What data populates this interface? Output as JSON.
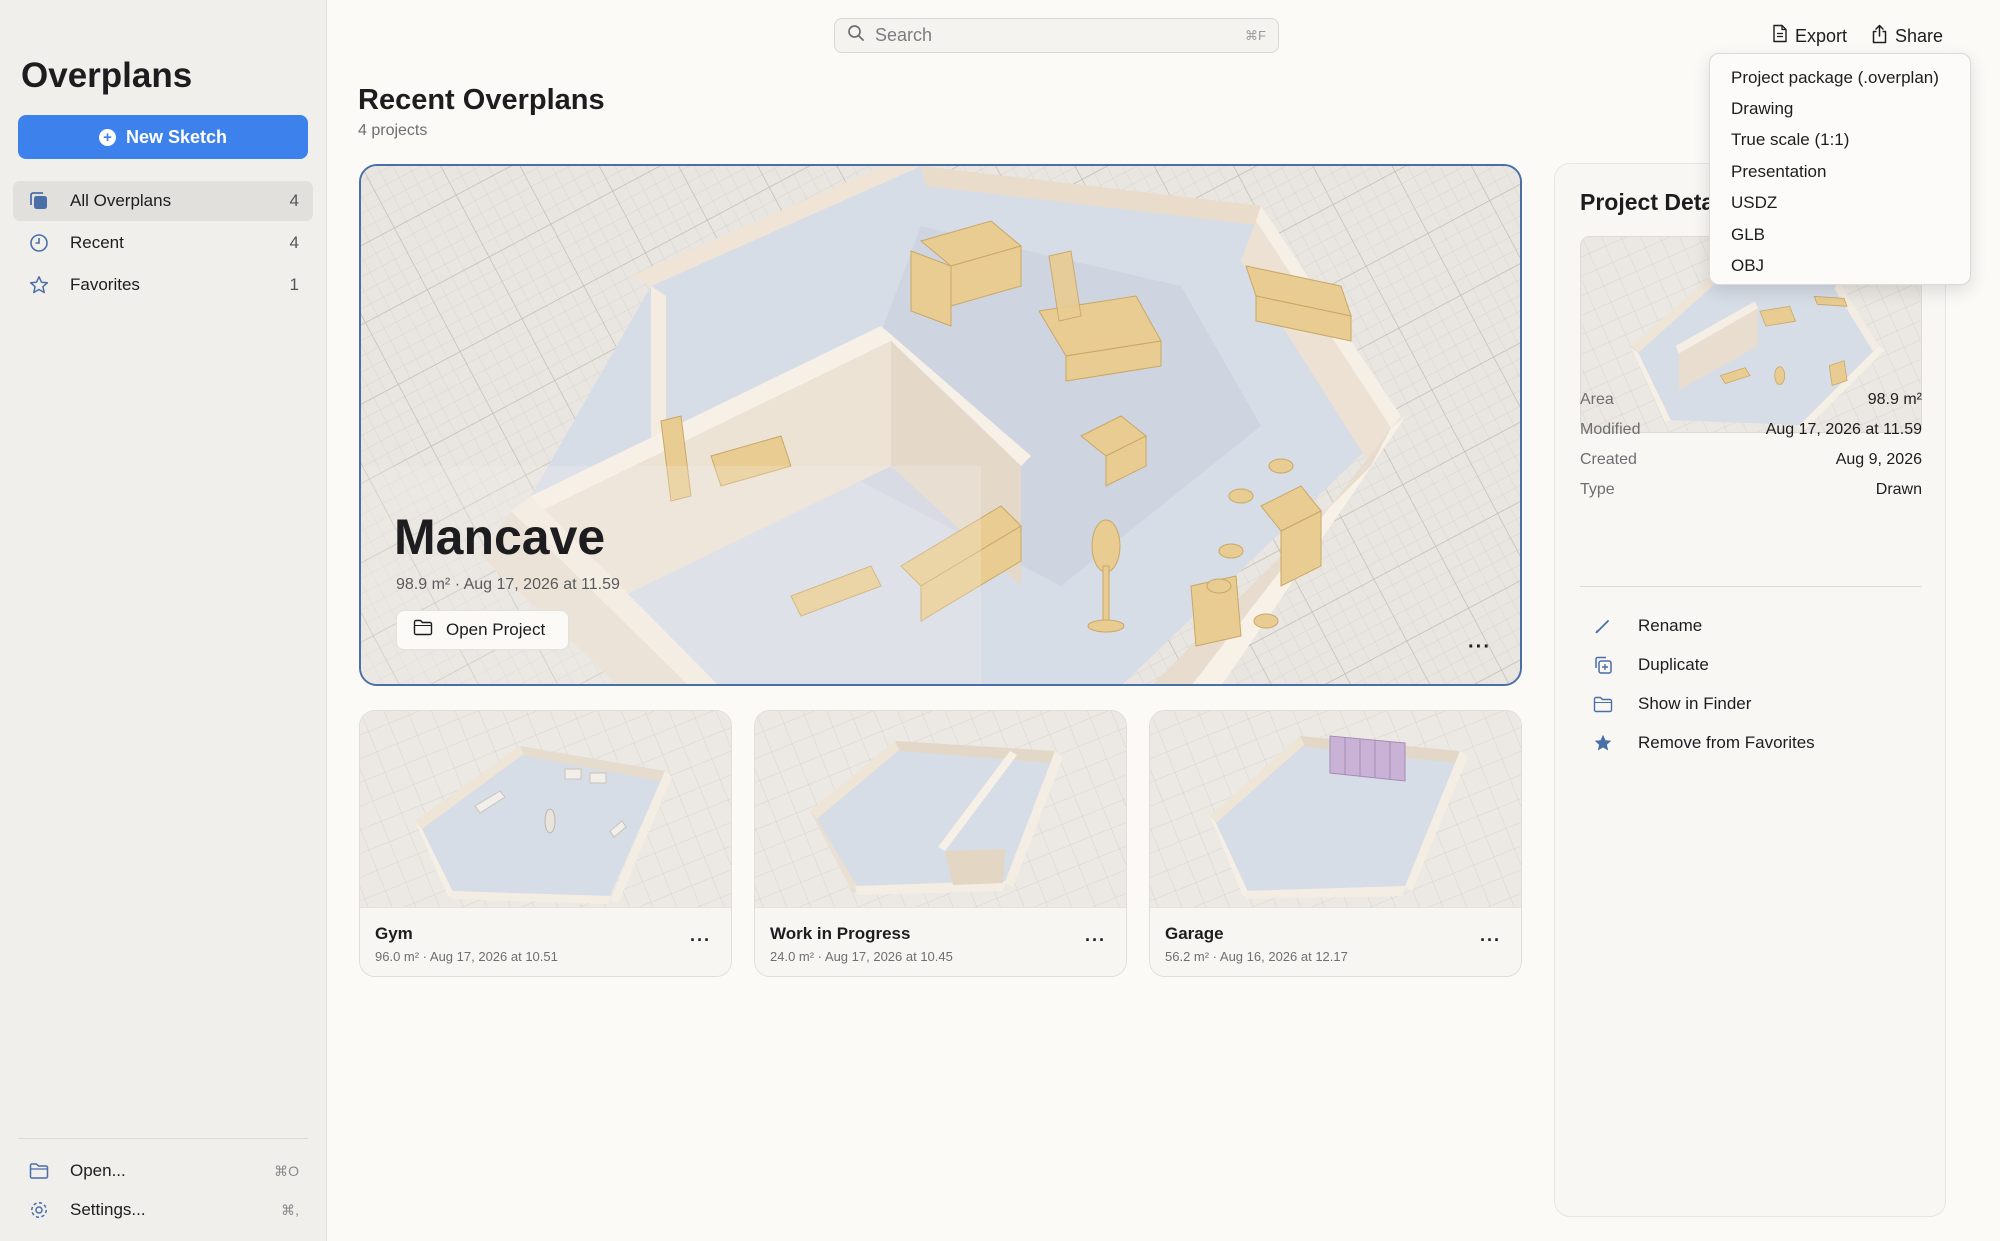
{
  "app": {
    "title": "Overplans"
  },
  "sidebar": {
    "new_sketch_label": "New Sketch",
    "items": [
      {
        "label": "All Overplans",
        "count": "4",
        "icon": "collection-icon"
      },
      {
        "label": "Recent",
        "count": "4",
        "icon": "clock-icon"
      },
      {
        "label": "Favorites",
        "count": "1",
        "icon": "star-icon"
      }
    ],
    "bottom": [
      {
        "label": "Open...",
        "shortcut": "⌘O",
        "icon": "folder-icon"
      },
      {
        "label": "Settings...",
        "shortcut": "⌘,",
        "icon": "gear-icon"
      }
    ]
  },
  "toolbar": {
    "search_placeholder": "Search",
    "search_shortcut": "⌘F",
    "export_label": "Export",
    "share_label": "Share"
  },
  "header": {
    "title": "Recent Overplans",
    "subtitle": "4 projects"
  },
  "hero": {
    "title": "Mancave",
    "meta": "98.9 m² · Aug 17, 2026 at 11.59",
    "open_label": "Open Project",
    "more_label": "···"
  },
  "cards": [
    {
      "name": "Gym",
      "meta": "96.0 m² · Aug 17, 2026 at 10.51",
      "more": "···"
    },
    {
      "name": "Work in Progress",
      "meta": "24.0 m² · Aug 17, 2026 at 10.45",
      "more": "···"
    },
    {
      "name": "Garage",
      "meta": "56.2 m² · Aug 16, 2026 at 12.17",
      "more": "···"
    }
  ],
  "details": {
    "title": "Project Details",
    "rows": [
      {
        "key": "Area",
        "value": "98.9 m²"
      },
      {
        "key": "Modified",
        "value": "Aug 17, 2026 at 11.59"
      },
      {
        "key": "Created",
        "value": "Aug 9, 2026"
      },
      {
        "key": "Type",
        "value": "Drawn"
      }
    ],
    "actions": [
      {
        "label": "Rename",
        "icon": "pencil-icon"
      },
      {
        "label": "Duplicate",
        "icon": "duplicate-icon"
      },
      {
        "label": "Show in Finder",
        "icon": "folder-icon"
      },
      {
        "label": "Remove from Favorites",
        "icon": "star-filled-icon"
      }
    ]
  },
  "export_menu": {
    "items": [
      "Project package (.overplan)",
      "Drawing",
      "True scale (1:1)",
      "Presentation",
      "USDZ",
      "GLB",
      "OBJ"
    ]
  },
  "colors": {
    "accent": "#3d82ec",
    "sidebar_bg": "#f0efec",
    "page_bg": "#fbfaf7",
    "hero_border": "#4a6fa8",
    "icon_blue": "#4a6fa8",
    "wall": "#f3ece2",
    "floor": "#d6dde7",
    "furniture": "#e9cc91"
  }
}
